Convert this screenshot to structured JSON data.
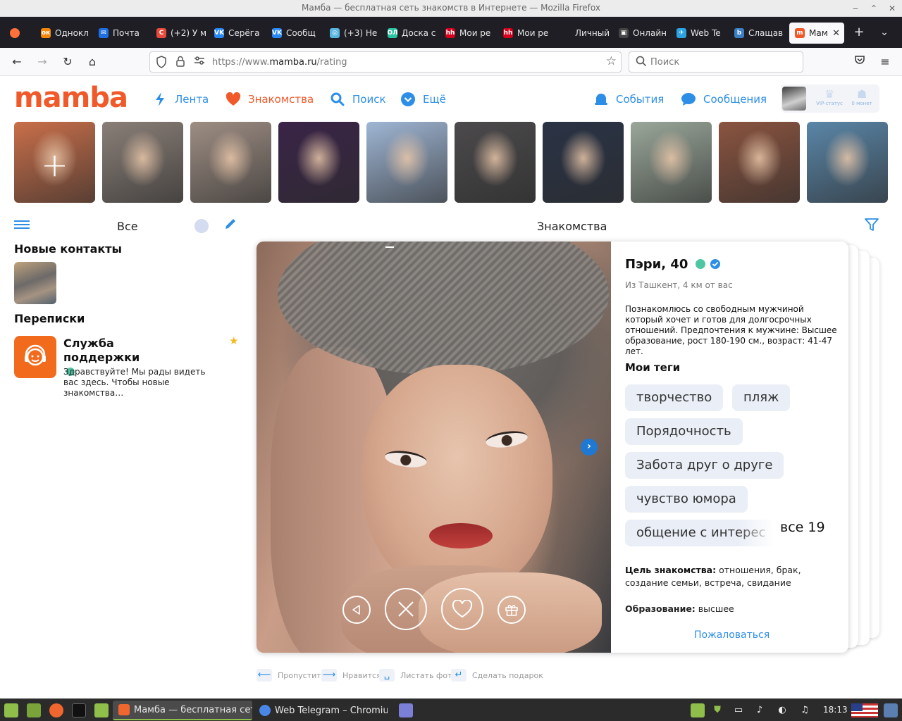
{
  "window": {
    "title": "Мамба — бесплатная сеть знакомств в Интернете — Mozilla Firefox"
  },
  "tabs": [
    {
      "label": "Однокл",
      "fav_color": "#f4870a",
      "fav_text": "ок"
    },
    {
      "label": "Почта",
      "fav_color": "#1e6fe0",
      "fav_text": "✉"
    },
    {
      "label": "(+2) У м",
      "fav_color": "#e84a3b",
      "fav_text": "С"
    },
    {
      "label": "Серёга",
      "fav_color": "#2787f5",
      "fav_text": "VK"
    },
    {
      "label": "Сообщ",
      "fav_color": "#2787f5",
      "fav_text": "VK"
    },
    {
      "label": "(+3) Не",
      "fav_color": "#5ab6e0",
      "fav_text": "◎"
    },
    {
      "label": "Доска с",
      "fav_color": "#2bc3a0",
      "fav_text": "OЛ"
    },
    {
      "label": "Мои ре",
      "fav_color": "#d6001c",
      "fav_text": "hh"
    },
    {
      "label": "Мои ре",
      "fav_color": "#d6001c",
      "fav_text": "hh"
    },
    {
      "label": "Личный ка",
      "fav_color": "#1f1e25",
      "fav_text": ""
    },
    {
      "label": "Онлайн",
      "fav_color": "#444444",
      "fav_text": "▣"
    },
    {
      "label": "Web Te",
      "fav_color": "#2aa3e0",
      "fav_text": "✈"
    },
    {
      "label": "Слащав",
      "fav_color": "#3b7fc4",
      "fav_text": "b"
    },
    {
      "label": "Мам",
      "fav_color": "#f0592a",
      "fav_text": "m"
    }
  ],
  "nav": {
    "url_prefix": "https://www.",
    "url_domain": "mamba.ru",
    "url_path": "/rating",
    "search_placeholder": "Поиск"
  },
  "site": {
    "logo": "mamba",
    "menu": [
      {
        "label": "Лента",
        "icon": "lightning-icon"
      },
      {
        "label": "Знакомства",
        "icon": "heart-icon"
      },
      {
        "label": "Поиск",
        "icon": "search-icon"
      },
      {
        "label": "Ещё",
        "icon": "chevron-down-icon"
      },
      {
        "label": "События",
        "icon": "bell-icon"
      },
      {
        "label": "Сообщения",
        "icon": "chat-icon"
      }
    ],
    "vip_label": "VIP-статус",
    "coins_label": "0 монет"
  },
  "stories_colors": [
    "#c96f4a",
    "#8a7f78",
    "#9e8e84",
    "#3a2448",
    "#9fb6d4",
    "#4c4a4c",
    "#2a3346",
    "#9aa79a",
    "#8b5440",
    "#5a86a8"
  ],
  "sidebar": {
    "filter_label": "Все",
    "new_contacts": "Новые контакты",
    "chats": "Переписки",
    "support_name": "Служба поддержки",
    "support_msg": "Здравствуйте! Мы рады видеть вас здесь. Чтобы новые знакомства…"
  },
  "main": {
    "title": "Знакомства",
    "profile": {
      "name": "Пэри, 40",
      "location": "Из Ташкент, 4 км от вас",
      "about": "Познакомлюсь со свободным мужчиной который хочет и готов для долгосрочных отношений. Предпочтения к мужчине: Высшее образование, рост 180-190 см., возраст: 41-47 лет.",
      "tags_heading": "Мои теги",
      "tags": [
        "творчество",
        "пляж",
        "Порядочность",
        "Забота друг о друге",
        "чувство юмора",
        "общение с интерес"
      ],
      "more_tags": "все 19",
      "goal_label": "Цель знакомства:",
      "goal_value": "отношения, брак, создание семьи, встреча, свидание",
      "edu_label": "Образование:",
      "edu_value": "высшее",
      "report": "Пожаловаться"
    }
  },
  "hotkeys": [
    {
      "key": "⟵",
      "label": "Пропустить"
    },
    {
      "key": "⟶",
      "label": "Нравится"
    },
    {
      "key": "␣",
      "label": "Листать фото"
    },
    {
      "key": "↵",
      "label": "Сделать подарок"
    }
  ],
  "taskbar": {
    "windows": [
      "Мамба — бесплатная сеть...",
      "Web Telegram – Chromium"
    ],
    "clock": "18:13"
  },
  "colors": {
    "brand": "#f0592a",
    "accent": "#2d8ee6",
    "online": "#4fc6a2"
  }
}
